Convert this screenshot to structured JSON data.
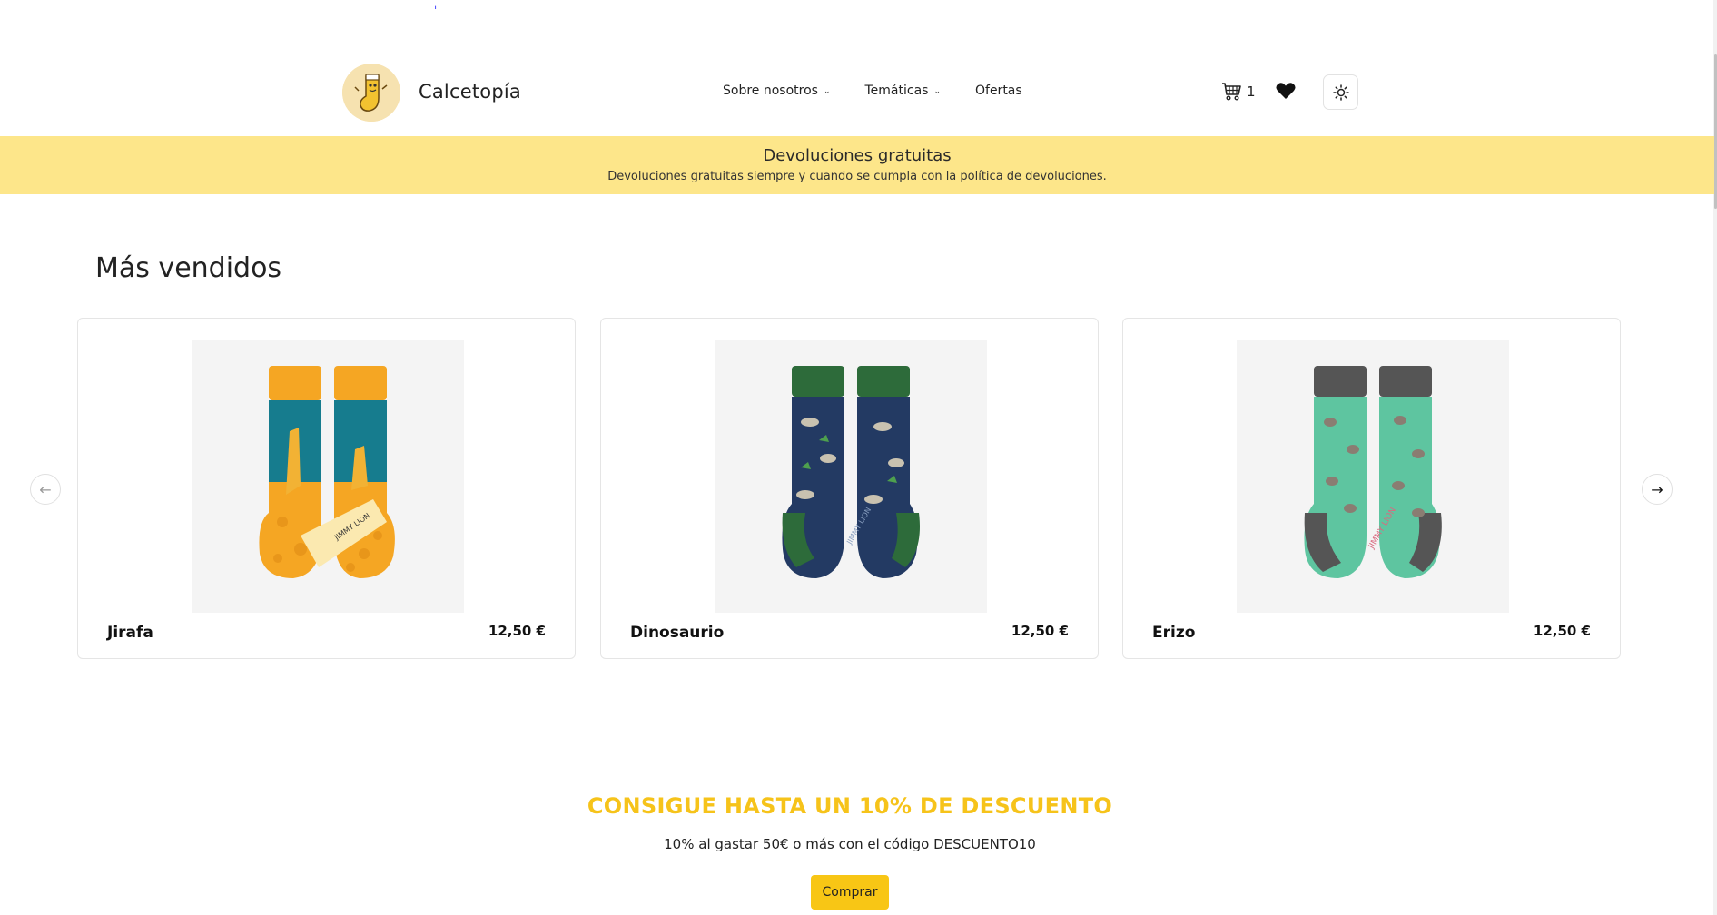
{
  "header": {
    "brand": "Calcetopía",
    "nav": [
      {
        "label": "Sobre nosotros",
        "has_dropdown": true
      },
      {
        "label": "Temáticas",
        "has_dropdown": true
      },
      {
        "label": "Ofertas",
        "has_dropdown": false
      }
    ],
    "cart_count": "1",
    "icons": [
      "cart-icon",
      "heart-icon",
      "sun-icon"
    ]
  },
  "banner": {
    "title": "Devoluciones gratuitas",
    "subtitle": "Devoluciones gratuitas siempre y cuando se cumpla con la política de devoluciones."
  },
  "bestsellers": {
    "title": "Más vendidos",
    "products": [
      {
        "name": "Jirafa",
        "price": "12,50 €"
      },
      {
        "name": "Dinosaurio",
        "price": "12,50 €"
      },
      {
        "name": "Erizo",
        "price": "12,50 €"
      }
    ]
  },
  "promo": {
    "title": "CONSIGUE HASTA UN 10% DE DESCUENTO",
    "subtitle": "10% al gastar 50€ o más con el código DESCUENTO10",
    "button": "Comprar"
  },
  "colors": {
    "banner_bg": "#fde68a",
    "accent": "#f8c615",
    "promo_title": "#f6c31a"
  }
}
